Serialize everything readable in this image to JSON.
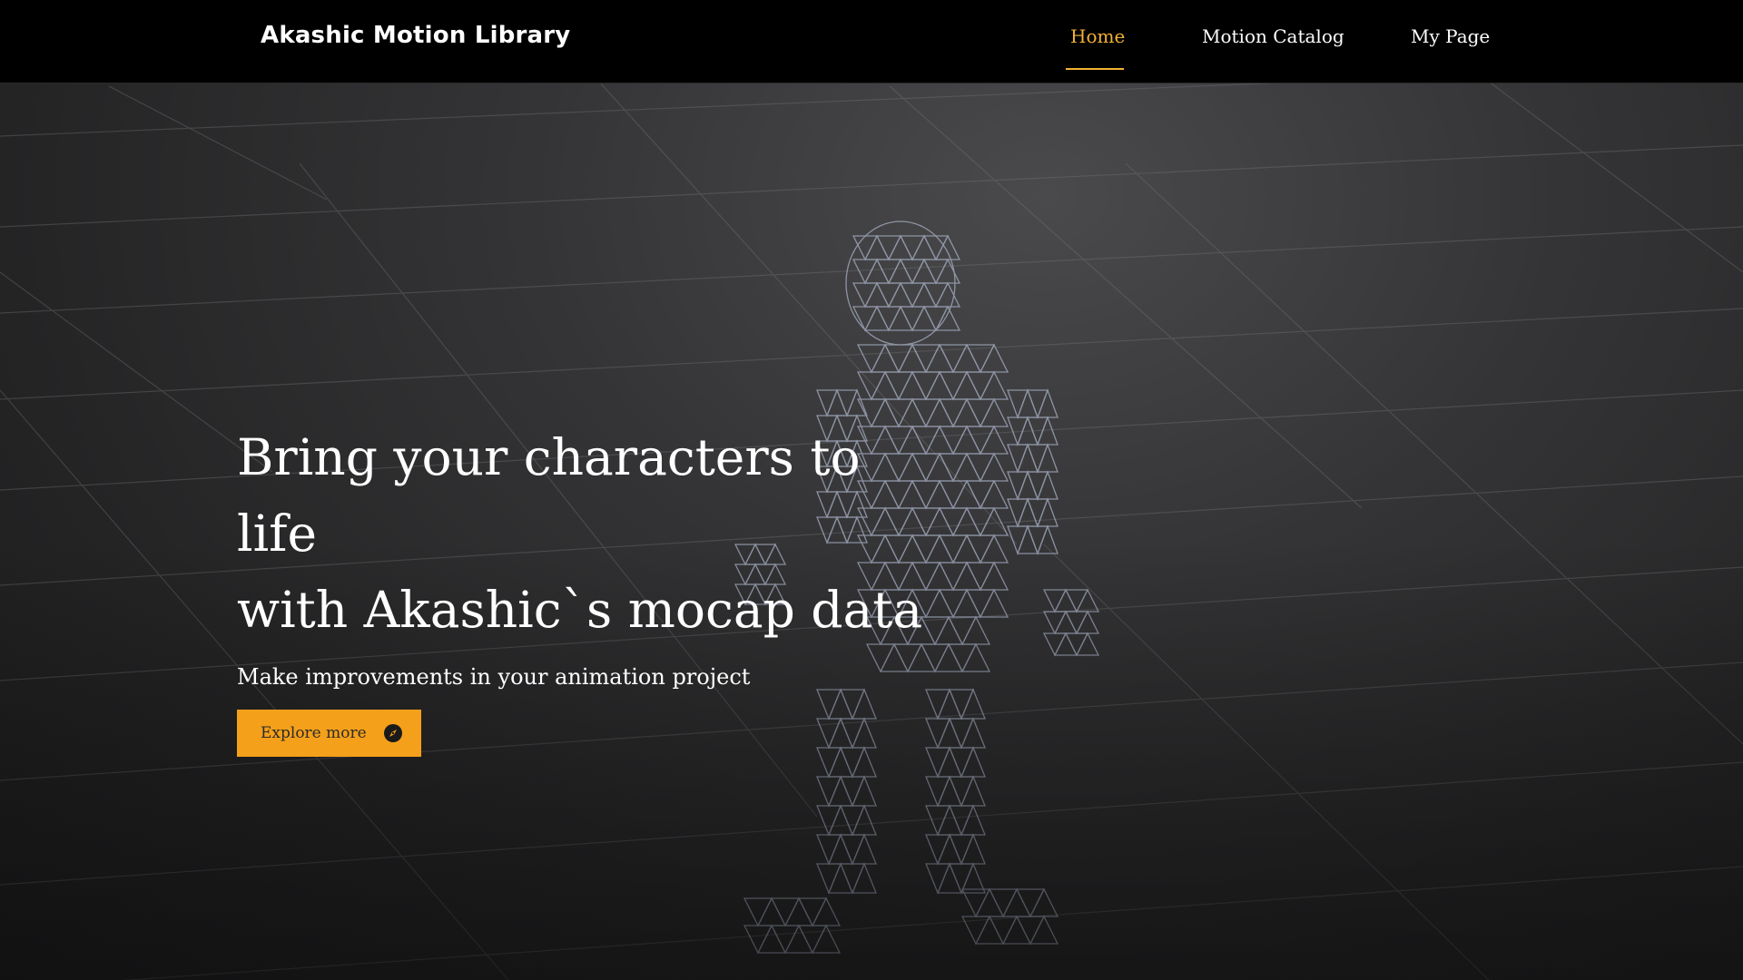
{
  "header": {
    "brand": "Akashic Motion Library",
    "nav": [
      {
        "label": "Home",
        "active": true
      },
      {
        "label": "Motion Catalog",
        "active": false
      },
      {
        "label": "My Page",
        "active": false
      }
    ]
  },
  "hero": {
    "headline_line1": "Bring your characters to life",
    "headline_line2": "with Akashic`s mocap data",
    "subline": "Make improvements in your animation project",
    "cta_label": "Explore more",
    "cta_icon": "compass-icon"
  },
  "colors": {
    "accent": "#f2b134",
    "button": "#f5a01a",
    "topbar": "#000000",
    "background": "#2a2a2b"
  }
}
